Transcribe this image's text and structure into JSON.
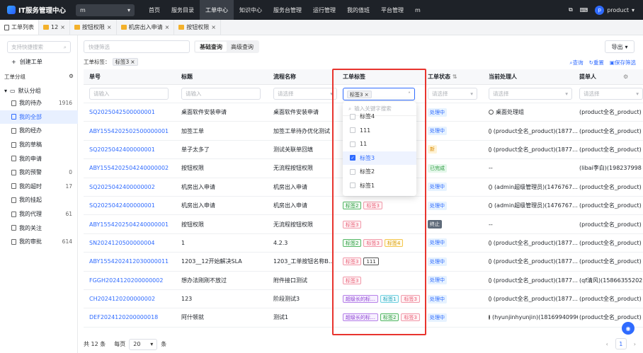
{
  "topbar": {
    "title": "IT服务管理中心",
    "app_select": "m",
    "nav": [
      "首页",
      "服务目录",
      "工单中心",
      "知识中心",
      "服务台管理",
      "运行管理",
      "我的值班",
      "平台管理",
      "m"
    ],
    "active_nav_index": 2,
    "user_initial": "p",
    "user_name": "product"
  },
  "tabs": [
    {
      "label": "工单列表",
      "closable": false,
      "active": true
    },
    {
      "label": "12",
      "closable": true
    },
    {
      "label": "按钮权限",
      "closable": true
    },
    {
      "label": "机房出入申请",
      "closable": true
    },
    {
      "label": "按钮权限",
      "closable": true
    }
  ],
  "sidebar": {
    "search_placeholder": "支持快捷搜索",
    "create_label": "创建工单",
    "group_title": "工单分组",
    "default_group": "默认分组",
    "items": [
      {
        "label": "我的待办",
        "count": "1916"
      },
      {
        "label": "我的全部",
        "count": "",
        "active": true
      },
      {
        "label": "我的经办",
        "count": ""
      },
      {
        "label": "我的草稿",
        "count": ""
      },
      {
        "label": "我的申请",
        "count": ""
      },
      {
        "label": "我的预警",
        "count": "0"
      },
      {
        "label": "我的超时",
        "count": "17"
      },
      {
        "label": "我的挂起",
        "count": ""
      },
      {
        "label": "我的代理",
        "count": "61"
      },
      {
        "label": "我的关注",
        "count": ""
      },
      {
        "label": "我的审批",
        "count": "614"
      }
    ]
  },
  "toolbar": {
    "filter_placeholder": "快捷筛选",
    "basic_query": "基础查询",
    "advanced_query": "高级查询",
    "export": "导出",
    "tag_filter_label": "工单标签：",
    "tag_filter_value": "标签3",
    "query": "查询",
    "reset": "重置",
    "save_filter": "保存筛选"
  },
  "columns": [
    "单号",
    "标题",
    "流程名称",
    "工单标签",
    "工单状态",
    "当前处理人",
    "提单人"
  ],
  "filters": {
    "input_placeholder": "请输入",
    "select_placeholder": "请选择",
    "tag_selected": "标签3"
  },
  "dropdown": {
    "search_placeholder": "输入关键字搜索",
    "options": [
      {
        "label": "标签4",
        "checked": false
      },
      {
        "label": "111",
        "checked": false
      },
      {
        "label": "11",
        "checked": false
      },
      {
        "label": "标签3",
        "checked": true
      },
      {
        "label": "标签2",
        "checked": false
      },
      {
        "label": "标签1",
        "checked": false
      }
    ]
  },
  "rows": [
    {
      "id": "SQ2025042500000001",
      "title": "桌面软件安装申请",
      "flow": "桌面软件安装申请",
      "tags": [],
      "status": "处理中",
      "handler": "桌面处理组",
      "submitter": "(product全名_product)"
    },
    {
      "id": "ABY1554202502500000001",
      "title": "加签工单",
      "flow": "加签工单待办优化测试",
      "tags": [],
      "status": "处理中",
      "handler": "(product全名_product)(1877…",
      "submitter": "(product全名_product)"
    },
    {
      "id": "SQ2025042400000001",
      "title": "单子太多了",
      "flow": "测试关联单回填",
      "tags": [],
      "status": "新",
      "handler": "(product全名_product)(1877…",
      "submitter": "(product全名_product)"
    },
    {
      "id": "ABY1554202504240000002",
      "title": "按钮权限",
      "flow": "无流程按钮权限",
      "tags": [],
      "status": "已完成",
      "handler": "--",
      "submitter": "(libai李白)(198237998"
    },
    {
      "id": "SQ2025042400000002",
      "title": "机房出入申请",
      "flow": "机房出入申请",
      "tags": [],
      "status": "处理中",
      "handler": "(admin超级管理员)(1476767…",
      "submitter": "(product全名_product)"
    },
    {
      "id": "SQ2025042400000001",
      "title": "机房出入申请",
      "flow": "机房出入申请",
      "tags": [
        {
          "t": "标签2",
          "c": "green"
        },
        {
          "t": "标签3",
          "c": "pink"
        }
      ],
      "status": "处理中",
      "handler": "(admin超级管理员)(1476767…",
      "submitter": "(product全名_product)"
    },
    {
      "id": "ABY1554202504240000001",
      "title": "按钮权限",
      "flow": "无流程按钮权限",
      "tags": [
        {
          "t": "标签3",
          "c": "pink"
        }
      ],
      "status": "终止",
      "handler": "--",
      "submitter": "(product全名_product)"
    },
    {
      "id": "SN2024120500000004",
      "title": "1",
      "flow": "4.2.3",
      "tags": [
        {
          "t": "标签2",
          "c": "green"
        },
        {
          "t": "标签3",
          "c": "pink"
        },
        {
          "t": "标签4",
          "c": "yellow"
        }
      ],
      "status": "处理中",
      "handler": "(product全名_product)(1877…",
      "submitter": "(product全名_product)"
    },
    {
      "id": "ABY1554202412030000011",
      "title": "1203__12开始解决SLA",
      "flow": "1203_工单按钮名称B…",
      "tags": [
        {
          "t": "标签3",
          "c": "pink"
        },
        {
          "t": "111",
          "c": "dark"
        }
      ],
      "status": "处理中",
      "handler": "(product全名_product)(1877…",
      "submitter": "(product全名_product)"
    },
    {
      "id": "FGGH2024120200000002",
      "title": "想办法刚刚不放过",
      "flow": "附件接口测试",
      "tags": [
        {
          "t": "标签3",
          "c": "pink"
        }
      ],
      "status": "处理中",
      "handler": "(product全名_product)(1877…",
      "submitter": "(qf清风)(15866355202)"
    },
    {
      "id": "CH2024120200000002",
      "title": "123",
      "flow": "阶段测试3",
      "tags": [
        {
          "t": "超级长的标…",
          "c": "purple"
        },
        {
          "t": "标签1",
          "c": "cyan"
        },
        {
          "t": "标签3",
          "c": "pink"
        }
      ],
      "status": "处理中",
      "handler": "(product全名_product)(1877…",
      "submitter": "(product全名_product)"
    },
    {
      "id": "DEF2024120200000018",
      "title": "阿什顿就",
      "flow": "测试1",
      "tags": [
        {
          "t": "超级长的标…",
          "c": "purple"
        },
        {
          "t": "标签2",
          "c": "green"
        },
        {
          "t": "标签3",
          "c": "pink"
        }
      ],
      "status": "处理中",
      "handler": "(hyunjinhyunjin)(18169940996)",
      "submitter": "(product全名_product)"
    }
  ],
  "status_colors": {
    "处理中": {
      "bg": "#e6f2ff",
      "fg": "#2f6bff"
    },
    "新": {
      "bg": "#fff3d6",
      "fg": "#d98a00"
    },
    "已完成": {
      "bg": "#e4f7ea",
      "fg": "#2c9b3f"
    },
    "终止": {
      "bg": "#5f6b7a",
      "fg": "#ffffff"
    }
  },
  "footer": {
    "total": "共 12 条",
    "per_page_label": "每页",
    "per_page": "20",
    "unit": "条",
    "current_page": "1"
  }
}
